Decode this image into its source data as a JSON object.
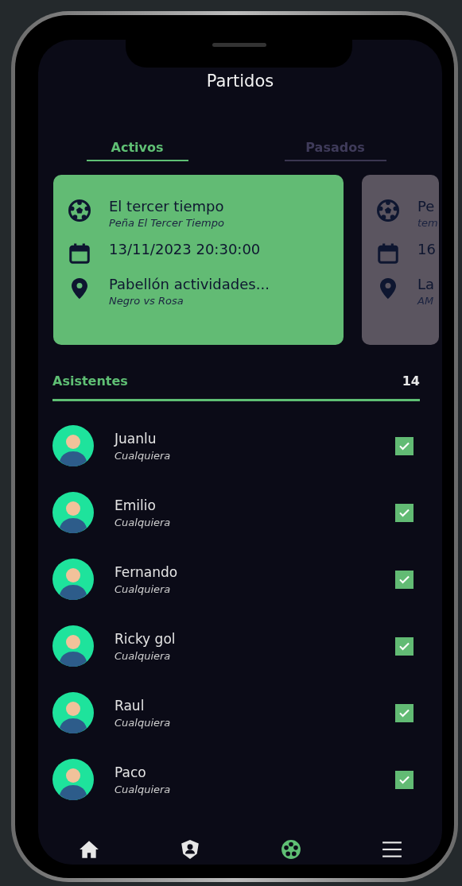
{
  "title": "Partidos",
  "tabs": [
    {
      "label": "Activos",
      "selected": true
    },
    {
      "label": "Pasados",
      "selected": false
    }
  ],
  "matches": [
    {
      "selected": true,
      "name": "El tercer tiempo",
      "team": "Peña El Tercer Tiempo",
      "date": "13/11/2023 20:30:00",
      "place": "Pabellón actividades...",
      "teams": "Negro vs Rosa"
    },
    {
      "selected": false,
      "name": "Pe",
      "team": "tem",
      "date": "16",
      "place": "La",
      "teams": "AM"
    }
  ],
  "attendees": {
    "label": "Asistentes",
    "count": "14",
    "players": [
      {
        "name": "Juanlu",
        "role": "Cualquiera",
        "checked": true
      },
      {
        "name": "Emilio",
        "role": "Cualquiera",
        "checked": true
      },
      {
        "name": "Fernando",
        "role": "Cualquiera",
        "checked": true
      },
      {
        "name": "Ricky gol",
        "role": "Cualquiera",
        "checked": true
      },
      {
        "name": "Raul",
        "role": "Cualquiera",
        "checked": true
      },
      {
        "name": "Paco",
        "role": "Cualquiera",
        "checked": true
      }
    ]
  },
  "nav": [
    {
      "kind": "home",
      "selected": false
    },
    {
      "kind": "profile",
      "selected": false
    },
    {
      "kind": "matches",
      "selected": true
    },
    {
      "kind": "menu",
      "selected": false
    }
  ]
}
